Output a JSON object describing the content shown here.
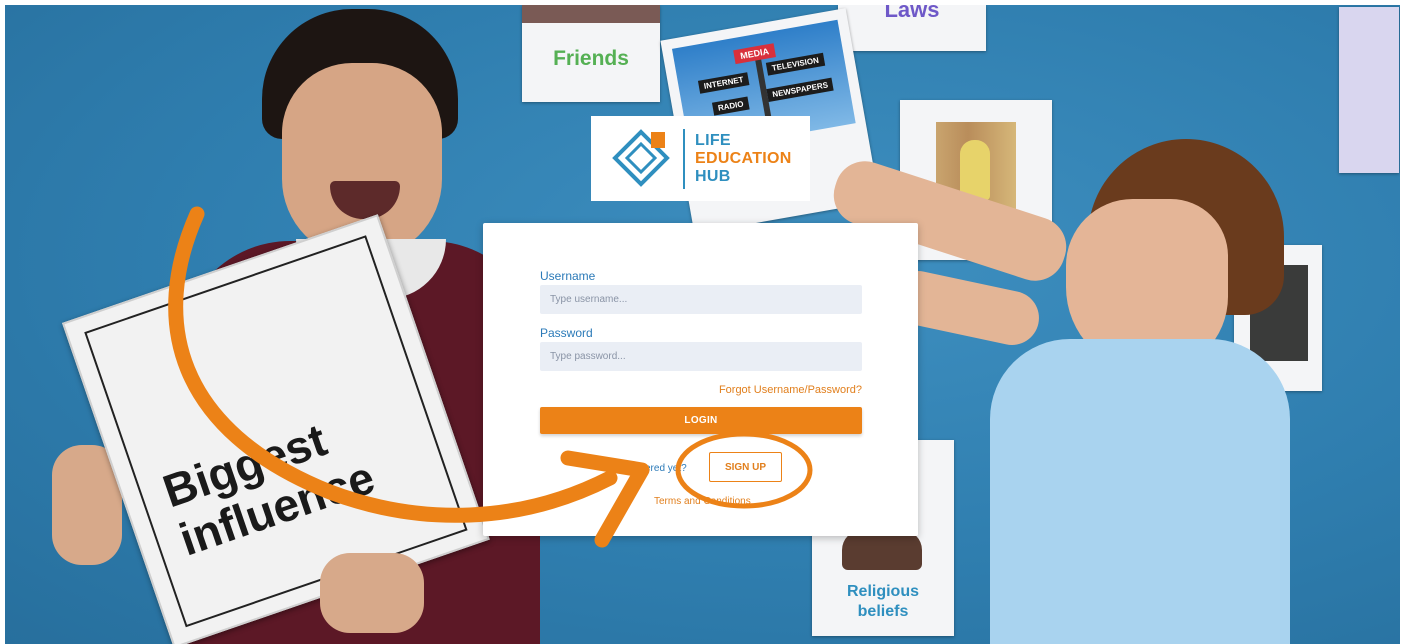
{
  "background": {
    "posters": {
      "friends": "Friends",
      "laws": "Laws",
      "media_sign": [
        "MEDIA",
        "INTERNET",
        "TELEVISION",
        "RADIO",
        "NEWSPAPERS"
      ],
      "religious": [
        "Religious",
        "beliefs"
      ],
      "biggest": [
        "Biggest",
        "influence"
      ]
    }
  },
  "logo": {
    "lines": [
      "LIFE",
      "EDUCATION",
      "HUB"
    ],
    "colors": {
      "blue": "#2f8fbf",
      "orange": "#ec8217"
    }
  },
  "login": {
    "username_label": "Username",
    "username_placeholder": "Type username...",
    "password_label": "Password",
    "password_placeholder": "Type password...",
    "forgot_link": "Forgot Username/Password?",
    "login_button": "LOGIN",
    "registered_text": "istered yet?",
    "signup_button": "SIGN UP",
    "terms_link": "Terms and Conditions"
  },
  "annotation": {
    "color": "#ec8217",
    "arrow-icon": "curved-arrow",
    "highlight-icon": "circle-highlight"
  }
}
